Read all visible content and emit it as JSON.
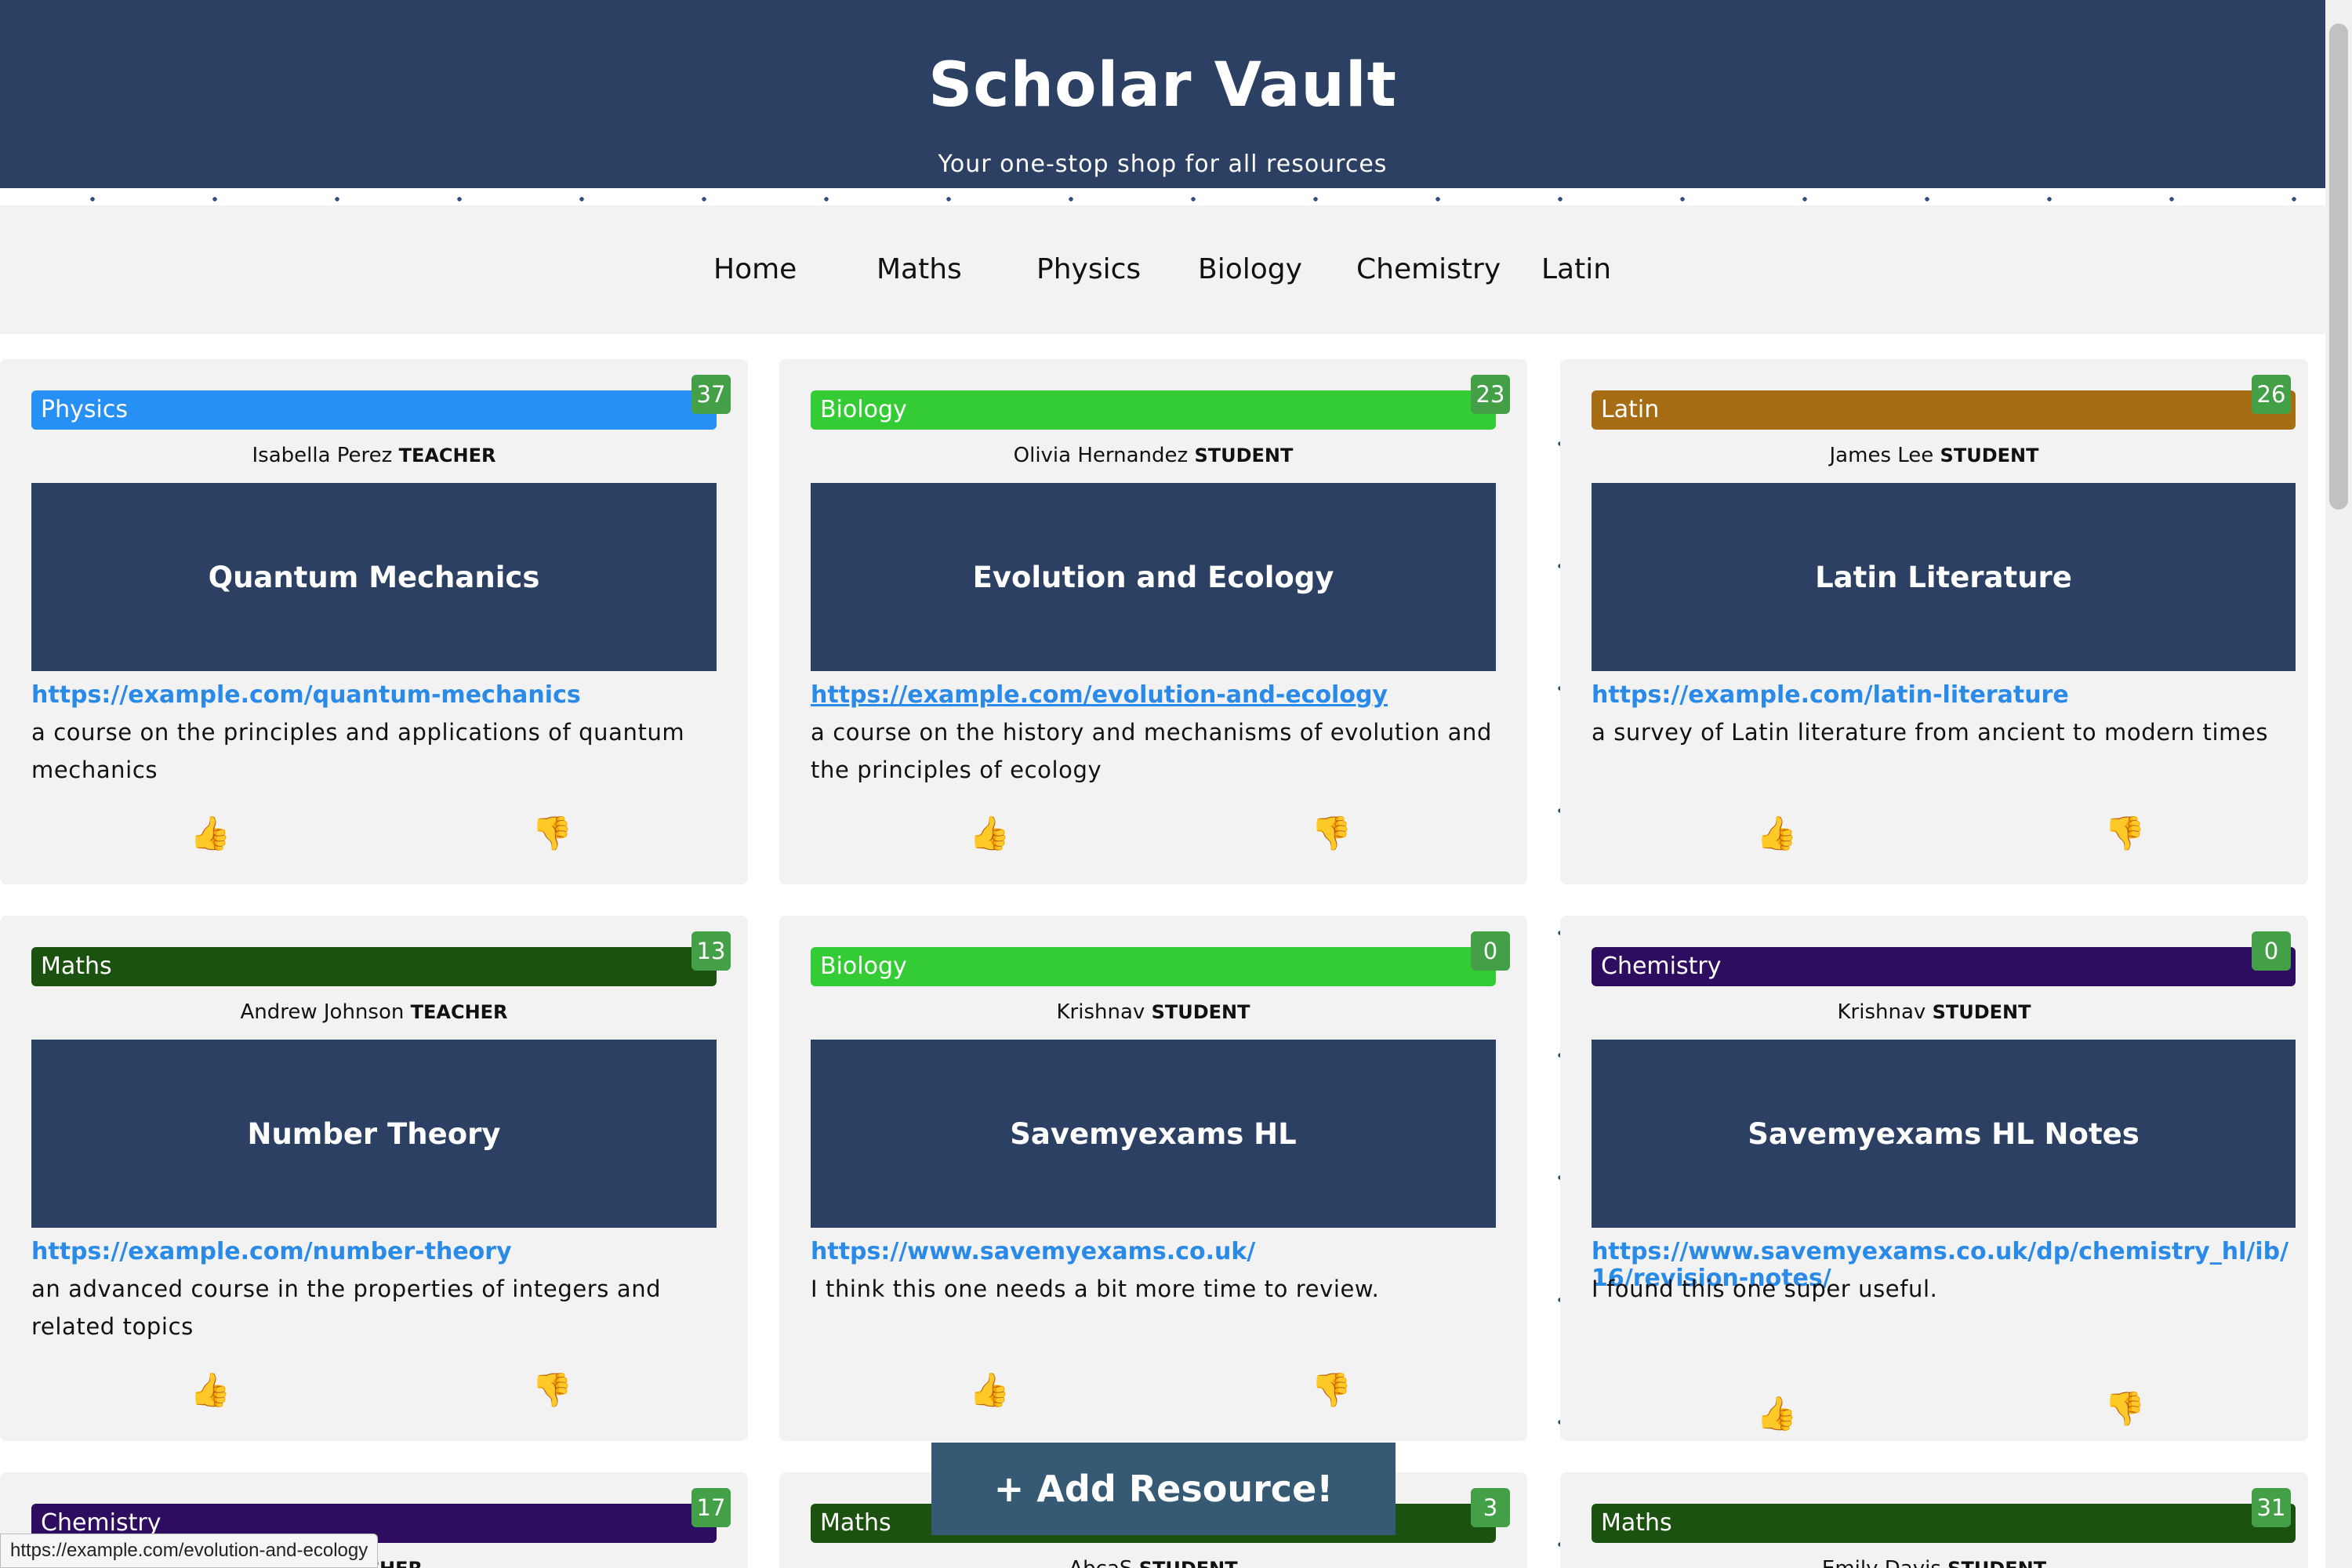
{
  "header": {
    "title": "Scholar Vault",
    "subtitle": "Your one-stop shop for all resources"
  },
  "nav": {
    "items": [
      "Home",
      "Maths",
      "Physics",
      "Biology",
      "Chemistry",
      "Latin"
    ]
  },
  "icons": {
    "thumbs_up": "👍",
    "thumbs_down": "👎"
  },
  "colors": {
    "header_bg": "#2c4063",
    "physics": "#2790f5",
    "biology": "#34cc35",
    "latin": "#a66d14",
    "maths": "#1c520f",
    "chemistry": "#2e0c5f",
    "count_badge": "#43a047",
    "link": "#2a8ae8"
  },
  "cards": [
    {
      "subject": "Physics",
      "count": "37",
      "author": "Isabella Perez",
      "role": "TEACHER",
      "title": "Quantum Mechanics",
      "url": "https://example.com/quantum-mechanics",
      "description": "a course on the principles and applications of quantum mechanics"
    },
    {
      "subject": "Biology",
      "count": "23",
      "author": "Olivia Hernandez",
      "role": "STUDENT",
      "title": "Evolution and Ecology",
      "url": "https://example.com/evolution-and-ecology",
      "description": "a course on the history and mechanisms of evolution and the principles of ecology"
    },
    {
      "subject": "Latin",
      "count": "26",
      "author": "James Lee",
      "role": "STUDENT",
      "title": "Latin Literature",
      "url": "https://example.com/latin-literature",
      "description": "a survey of Latin literature from ancient to modern times"
    },
    {
      "subject": "Maths",
      "count": "13",
      "author": "Andrew Johnson",
      "role": "TEACHER",
      "title": "Number Theory",
      "url": "https://example.com/number-theory",
      "description": "an advanced course in the properties of integers and related topics"
    },
    {
      "subject": "Biology",
      "count": "0",
      "author": "Krishnav",
      "role": "STUDENT",
      "title": "Savemyexams HL",
      "url": "https://www.savemyexams.co.uk/",
      "description": "I think this one needs a bit more time to review."
    },
    {
      "subject": "Chemistry",
      "count": "0",
      "author": "Krishnav",
      "role": "STUDENT",
      "title": "Savemyexams HL Notes",
      "url": "https://www.savemyexams.co.uk/dp/chemistry_hl/ib/16/revision-notes/",
      "description": "I found this one super useful."
    },
    {
      "subject": "Chemistry",
      "count": "17",
      "author": "",
      "role": "TEACHER"
    },
    {
      "subject": "Maths",
      "count": "3",
      "author": "AbcaS",
      "role": "STUDENT"
    },
    {
      "subject": "Maths",
      "count": "31",
      "author": "Emily Davis",
      "role": "STUDENT"
    }
  ],
  "add_button": {
    "label": "+ Add Resource!"
  },
  "status_bar": {
    "url": "https://example.com/evolution-and-ecology"
  }
}
